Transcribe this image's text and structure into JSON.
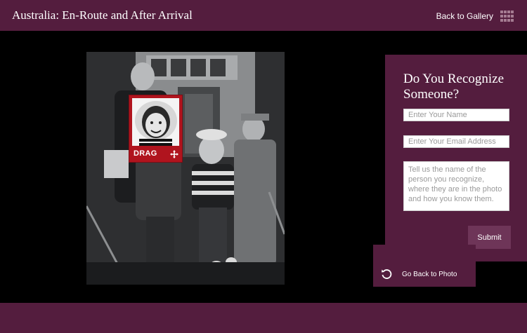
{
  "header": {
    "title": "Australia: En-Route and After Arrival",
    "back_to_gallery": "Back to Gallery",
    "gallery_icon": "grid-icon"
  },
  "photo": {
    "drag_label": "DRAG",
    "drag_icon": "move-icon"
  },
  "form": {
    "heading": "Do You Recognize Someone?",
    "name_placeholder": "Enter Your Name",
    "email_placeholder": "Enter Your Email Address",
    "message_placeholder": "Tell us the name of the person you recognize, where they are in the photo and how you know them.",
    "submit_label": "Submit"
  },
  "back_to_photo": {
    "label": "Go Back to Photo",
    "icon": "undo-icon"
  },
  "colors": {
    "brand": "#541d3e",
    "accent": "#b0141e",
    "button": "#6e3558"
  }
}
